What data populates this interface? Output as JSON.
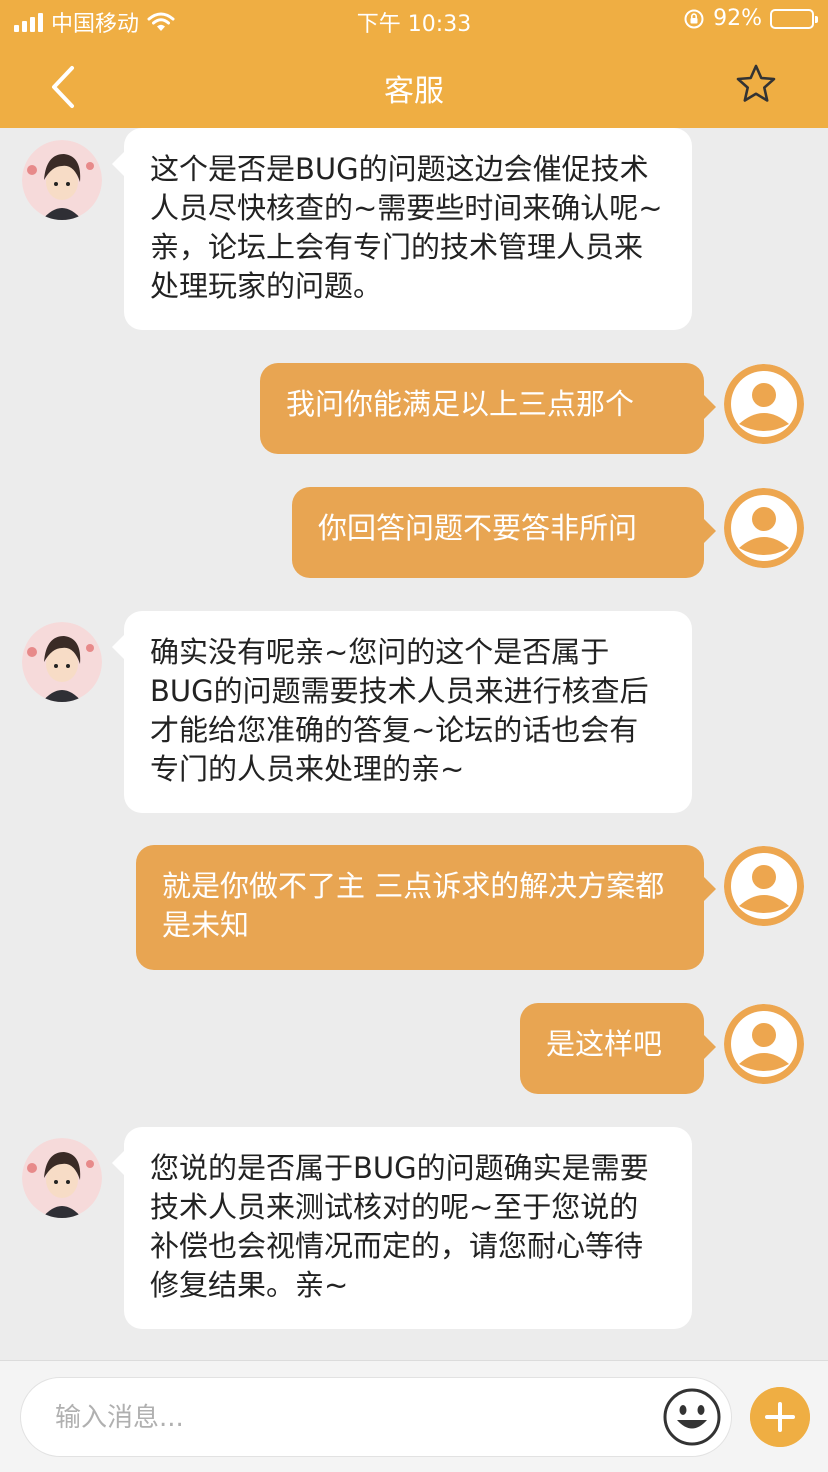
{
  "status_bar": {
    "carrier": "中国移动",
    "time": "下午 10:33",
    "battery_percent": "92%",
    "battery_level": 0.92
  },
  "header": {
    "title": "客服",
    "back_icon": "chevron-left-icon",
    "favorite_icon": "star-outline-icon"
  },
  "colors": {
    "accent": "#efae43",
    "user_bubble": "#e8a552",
    "agent_bubble": "#ffffff",
    "background": "#ececec"
  },
  "messages": [
    {
      "sender": "agent",
      "text": "这个是否是BUG的问题这边会催促技术人员尽快核查的~需要些时间来确认呢~亲，论坛上会有专门的技术管理人员来处理玩家的问题。"
    },
    {
      "sender": "user",
      "text": "我问你能满足以上三点那个"
    },
    {
      "sender": "user",
      "text": "你回答问题不要答非所问"
    },
    {
      "sender": "agent",
      "text": "确实没有呢亲~您问的这个是否属于BUG的问题需要技术人员来进行核查后才能给您准确的答复~论坛的话也会有专门的人员来处理的亲~"
    },
    {
      "sender": "user",
      "text": "就是你做不了主  三点诉求的解决方案都是未知"
    },
    {
      "sender": "user",
      "text": "是这样吧"
    },
    {
      "sender": "agent",
      "text": "您说的是否属于BUG的问题确实是需要技术人员来测试核对的呢~至于您说的补偿也会视情况而定的，请您耐心等待修复结果。亲~"
    }
  ],
  "composer": {
    "placeholder": "输入消息...",
    "value": "",
    "emoji_icon": "smiley-icon",
    "plus_icon": "plus-icon"
  }
}
